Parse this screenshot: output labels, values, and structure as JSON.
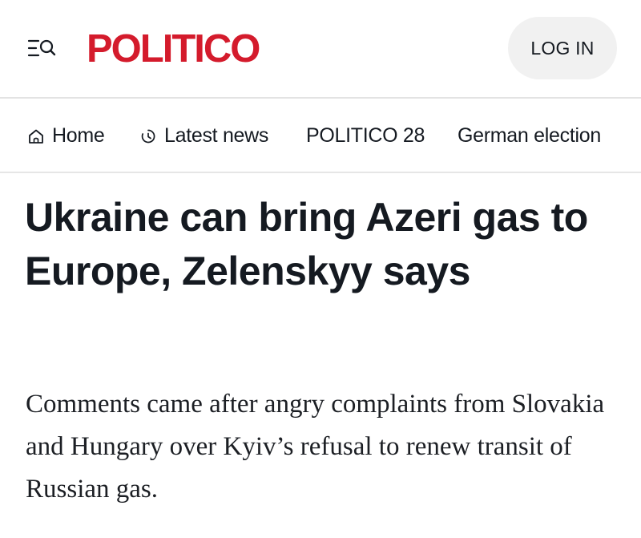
{
  "header": {
    "menu_icon": "menu-search-icon",
    "logo_text": "POLITICO",
    "login_label": "LOG IN"
  },
  "nav": {
    "items": [
      {
        "label": "Home",
        "icon": "home-icon"
      },
      {
        "label": "Latest news",
        "icon": "clock-icon"
      },
      {
        "label": "POLITICO 28"
      },
      {
        "label": "German election"
      }
    ]
  },
  "article": {
    "headline": "Ukraine can bring Azeri gas to Europe, Zelenskyy says",
    "dek": "Comments came after angry complaints from Slovakia and Hungary over Kyiv’s refusal to renew transit of Russian gas."
  },
  "colors": {
    "brand": "#d41b2c",
    "text": "#151a21",
    "login_bg": "#f1f1f1",
    "divider": "#e3e3e3"
  }
}
